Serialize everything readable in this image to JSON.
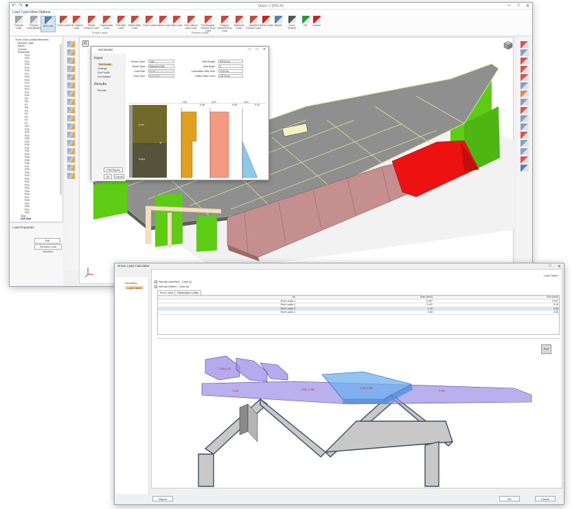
{
  "app": {
    "window_title": "Stats+ 1 (BS5.B)",
    "quick_access": [
      "↶",
      "↷",
      "■"
    ],
    "tabs": [
      "Load Types",
      "View Options"
    ],
    "ribbon_groups": [
      "Frame Loads",
      "Surface Loads"
    ],
    "ribbon_buttons": [
      {
        "label": "Thermal Load",
        "color": "#9aa4ad"
      },
      {
        "label": "Thermal Load (Beam)",
        "color": "#9aa4ad"
      },
      {
        "label": "Soil Load",
        "color": "#5a7fb0"
      },
      {
        "label": "Point Load",
        "color": "#c8483a"
      },
      {
        "label": "Full Uniform Load",
        "color": "#c8483a"
      },
      {
        "label": "Partial Uniform Load",
        "color": "#c8483a"
      },
      {
        "label": "Trapezoidal Load",
        "color": "#c8483a"
      },
      {
        "label": "Full Wall Load",
        "color": "#c8483a"
      },
      {
        "label": "Partial Wall Load",
        "color": "#c8483a"
      },
      {
        "label": "Point Load",
        "color": "#c8483a"
      },
      {
        "label": "Uniform Load",
        "color": "#c8483a"
      },
      {
        "label": "Wall Load",
        "color": "#c8483a"
      },
      {
        "label": "Full Uniform Area Load",
        "color": "#c8483a"
      },
      {
        "label": "Rectangular Uniform Area Load",
        "color": "#c8483a"
      },
      {
        "label": "Polygon Uniform Area Load",
        "color": "#c8483a"
      },
      {
        "label": "Wall Area Load",
        "color": "#c8483a"
      },
      {
        "label": "Variable Surface Load",
        "color": "#c8483a"
      },
      {
        "label": "Delete Loads",
        "color": "#cc2222"
      },
      {
        "label": "Report",
        "color": "#5a7fb0"
      },
      {
        "label": "Zoom Extents",
        "color": "#555555"
      },
      {
        "label": "OK",
        "color": "#2a9a3a"
      },
      {
        "label": "Cancel",
        "color": "#cc2222"
      }
    ]
  },
  "tree": {
    "items": [
      "Show Only Loaded Members",
      "Member Type",
      "Beam",
      "Column",
      "Shearwall",
      "P23",
      "P22",
      "P21",
      "P20",
      "P19",
      "P18",
      "P17",
      "P16",
      "P15",
      "P14",
      "P13",
      "P12",
      "P11",
      "P10",
      "P9",
      "P8",
      "P7",
      "P6",
      "P5",
      "P4",
      "P3",
      "P2",
      "P1",
      "P27",
      "P26",
      "P25",
      "P24",
      "P30",
      "P29",
      "P28",
      "P31",
      "P32",
      "P33",
      "P34",
      "P35",
      "P36",
      "P37",
      "P38",
      "P39",
      "P40",
      "P41",
      "P42",
      "P43",
      "P44",
      "P45",
      "P46",
      "P47",
      "P48",
      "P49",
      "P50",
      "P51",
      "P52",
      "Slab",
      "Soil Total"
    ],
    "load_properties_title": "Load Properties",
    "edit_label": "Edit",
    "reverse_label": "Reverse Load Direction"
  },
  "soil_dialog": {
    "title": "Soil Model",
    "gbadge": "G",
    "input_header": "Input",
    "nav": [
      "Soil Model",
      "Settings",
      "Soil Profile",
      "Surcharges"
    ],
    "results_header": "Results",
    "results_item": "Results",
    "print_report": "Print Report",
    "ok": "OK",
    "cancel": "Cancel",
    "fields_left": [
      {
        "label": "Model Label :",
        "value": "Total",
        "disabled": false
      },
      {
        "label": "Model Type :",
        "value": "Basement Wall",
        "disabled": false
      },
      {
        "label": "Load Side :",
        "value": "At top",
        "disabled": true
      },
      {
        "label": "Load Tarm :",
        "value": "Long Term",
        "disabled": true
      }
    ],
    "fields_right": [
      {
        "label": "Wall Height :",
        "value": "300.00 cm"
      },
      {
        "label": "Wall Angle :",
        "value": "0"
      },
      {
        "label": "Calculation Step Size :",
        "value": "10.00 cm"
      },
      {
        "label": "Water Table Level :",
        "value": "100.00 cm"
      }
    ],
    "layers": [
      "Kum",
      "Kaya"
    ],
    "plot_labels": [
      "LD1",
      "LD2",
      "LD3"
    ],
    "plot_values": [
      "0.08",
      "0.08",
      "0.05"
    ]
  },
  "snow": {
    "title": "Snow Load Calculator",
    "nav": [
      "Geometry",
      "Load Cases"
    ],
    "load_cases_label": "Load Cases",
    "cases": [
      "Normal Undrifted - Case (i)",
      "Normal Drifted - Case (ii)"
    ],
    "tabs": [
      "Roof Loads",
      "Obstruction Loads"
    ],
    "table": {
      "headers": [
        "No",
        "Start (t/m2)",
        "End (t/m2)"
      ],
      "rows": [
        [
          "Roof Loads 1",
          "0.057",
          "0.057"
        ],
        [
          "Roof Loads 2",
          "0.057",
          "0.18"
        ],
        [
          "Roof Loads 3",
          "0.18",
          "0.08"
        ],
        [
          "Roof Loads 4",
          "0.08",
          "0.08"
        ]
      ]
    },
    "view_labels": [
      "0.060-0.05",
      "0.087",
      "0.057-0.160",
      "0.160-0.060",
      "0.060"
    ],
    "print_label": "Print",
    "report": "Report",
    "ok": "OK",
    "cancel": "Cancel"
  },
  "colors": {
    "slab_gray": "#8f8f8f",
    "wall_green": "#5ccc14",
    "snow_red": "#ee1111",
    "pink_load": "#c58f8f",
    "snow_purple": "#9b8ee6",
    "snow_blue": "#6fb0ee",
    "soil_olive": "#6f6a2a",
    "soil_orange": "#e0a11f",
    "soil_salmon": "#f59a82",
    "soil_lightblue": "#8ec8ea"
  }
}
